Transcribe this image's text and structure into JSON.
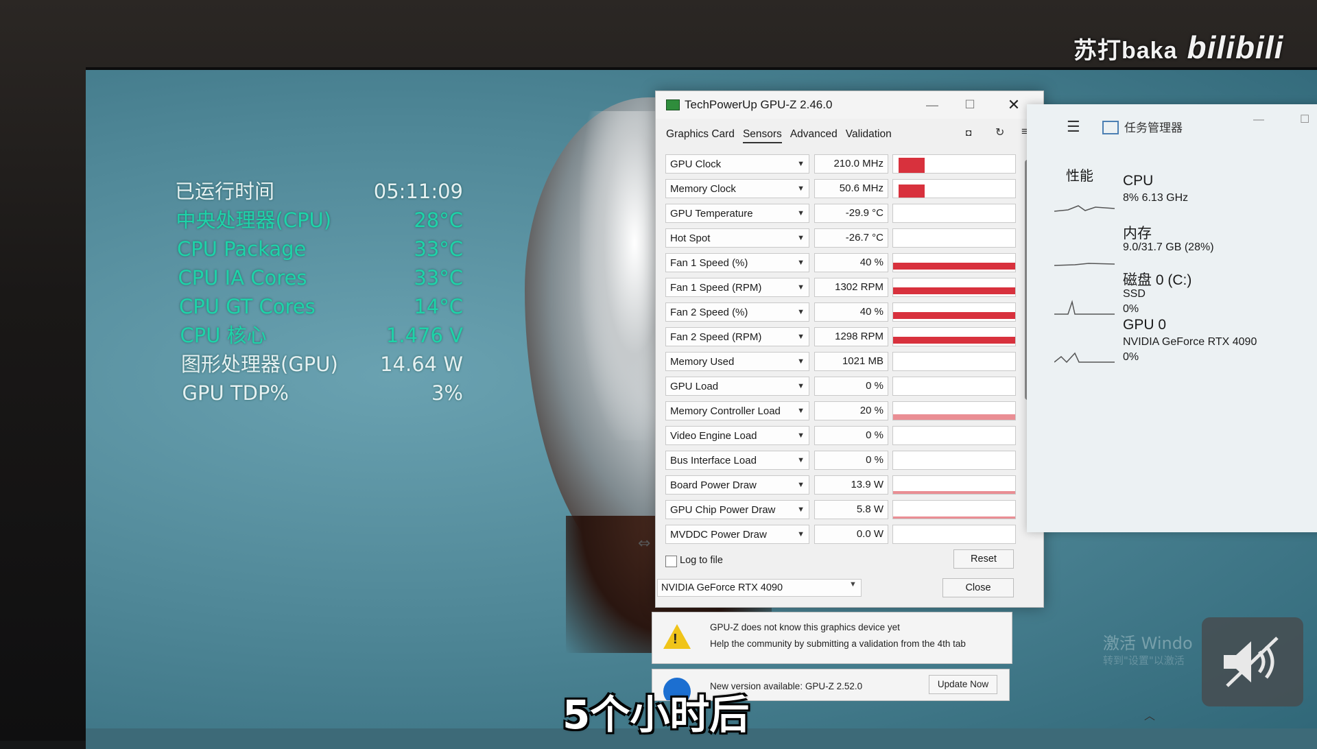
{
  "watermark": {
    "channel": "苏打baka",
    "logo": "bilibili"
  },
  "overlay": {
    "rows": [
      {
        "label": "已运行时间",
        "value": "05:11:09"
      },
      {
        "label": "中央处理器(CPU)",
        "value": "28°C"
      },
      {
        "label": "CPU Package",
        "value": "33°C"
      },
      {
        "label": "CPU IA Cores",
        "value": "33°C"
      },
      {
        "label": "CPU GT Cores",
        "value": "14°C"
      },
      {
        "label": "CPU 核心",
        "value": "1.476 V"
      },
      {
        "label": "图形处理器(GPU)",
        "value": "14.64 W"
      },
      {
        "label": "GPU TDP%",
        "value": "3%"
      }
    ]
  },
  "gpuz": {
    "title": "TechPowerUp GPU-Z 2.46.0",
    "tabs": [
      "Graphics Card",
      "Sensors",
      "Advanced",
      "Validation"
    ],
    "active_tab": "Sensors",
    "sensors": [
      {
        "name": "GPU Clock",
        "value": "210.0 MHz",
        "graph": "spike",
        "level": 0.85
      },
      {
        "name": "Memory Clock",
        "value": "50.6 MHz",
        "graph": "spike",
        "level": 0.75
      },
      {
        "name": "GPU Temperature",
        "value": "-29.9 °C",
        "graph": "none",
        "level": 0
      },
      {
        "name": "Hot Spot",
        "value": "-26.7 °C",
        "graph": "none",
        "level": 0
      },
      {
        "name": "Fan 1 Speed (%)",
        "value": "40 %",
        "graph": "bar",
        "level": 1
      },
      {
        "name": "Fan 1 Speed (RPM)",
        "value": "1302 RPM",
        "graph": "bar",
        "level": 1
      },
      {
        "name": "Fan 2 Speed (%)",
        "value": "40 %",
        "graph": "bar",
        "level": 1
      },
      {
        "name": "Fan 2 Speed (RPM)",
        "value": "1298 RPM",
        "graph": "bar",
        "level": 1
      },
      {
        "name": "Memory Used",
        "value": "1021 MB",
        "graph": "none",
        "level": 0
      },
      {
        "name": "GPU Load",
        "value": "0 %",
        "graph": "none",
        "level": 0
      },
      {
        "name": "Memory Controller Load",
        "value": "20 %",
        "graph": "noise",
        "level": 0.3
      },
      {
        "name": "Video Engine Load",
        "value": "0 %",
        "graph": "none",
        "level": 0
      },
      {
        "name": "Bus Interface Load",
        "value": "0 %",
        "graph": "none",
        "level": 0
      },
      {
        "name": "Board Power Draw",
        "value": "13.9 W",
        "graph": "noise",
        "level": 0.15
      },
      {
        "name": "GPU Chip Power Draw",
        "value": "5.8 W",
        "graph": "noise",
        "level": 0.12
      },
      {
        "name": "MVDDC Power Draw",
        "value": "0.0 W",
        "graph": "none",
        "level": 0
      }
    ],
    "log_label": "Log to file",
    "reset_label": "Reset",
    "gpu_select": "NVIDIA GeForce RTX 4090",
    "close_label": "Close"
  },
  "notice": {
    "line1": "GPU-Z does not know this graphics device yet",
    "line2": "Help the community by submitting a validation from the 4th tab",
    "update_text": "New version available: GPU-Z 2.52.0",
    "update_button": "Update Now"
  },
  "taskmgr": {
    "title": "任务管理器",
    "section": "性能",
    "items": [
      {
        "name": "CPU",
        "line1": "8%  6.13 GHz",
        "line2": ""
      },
      {
        "name": "内存",
        "line1": "9.0/31.7 GB (28%)",
        "line2": ""
      },
      {
        "name": "磁盘 0 (C:)",
        "line1": "SSD",
        "line2": "0%"
      },
      {
        "name": "GPU 0",
        "line1": "NVIDIA GeForce RTX 4090",
        "line2": "0%"
      }
    ]
  },
  "activation": {
    "title": "激活 Windo",
    "sub": "转到\"设置\"以激活"
  },
  "subtitle": "5个小时后",
  "colors": {
    "overlay_green": "#1ed3a8",
    "graph_red": "#d8313d"
  }
}
